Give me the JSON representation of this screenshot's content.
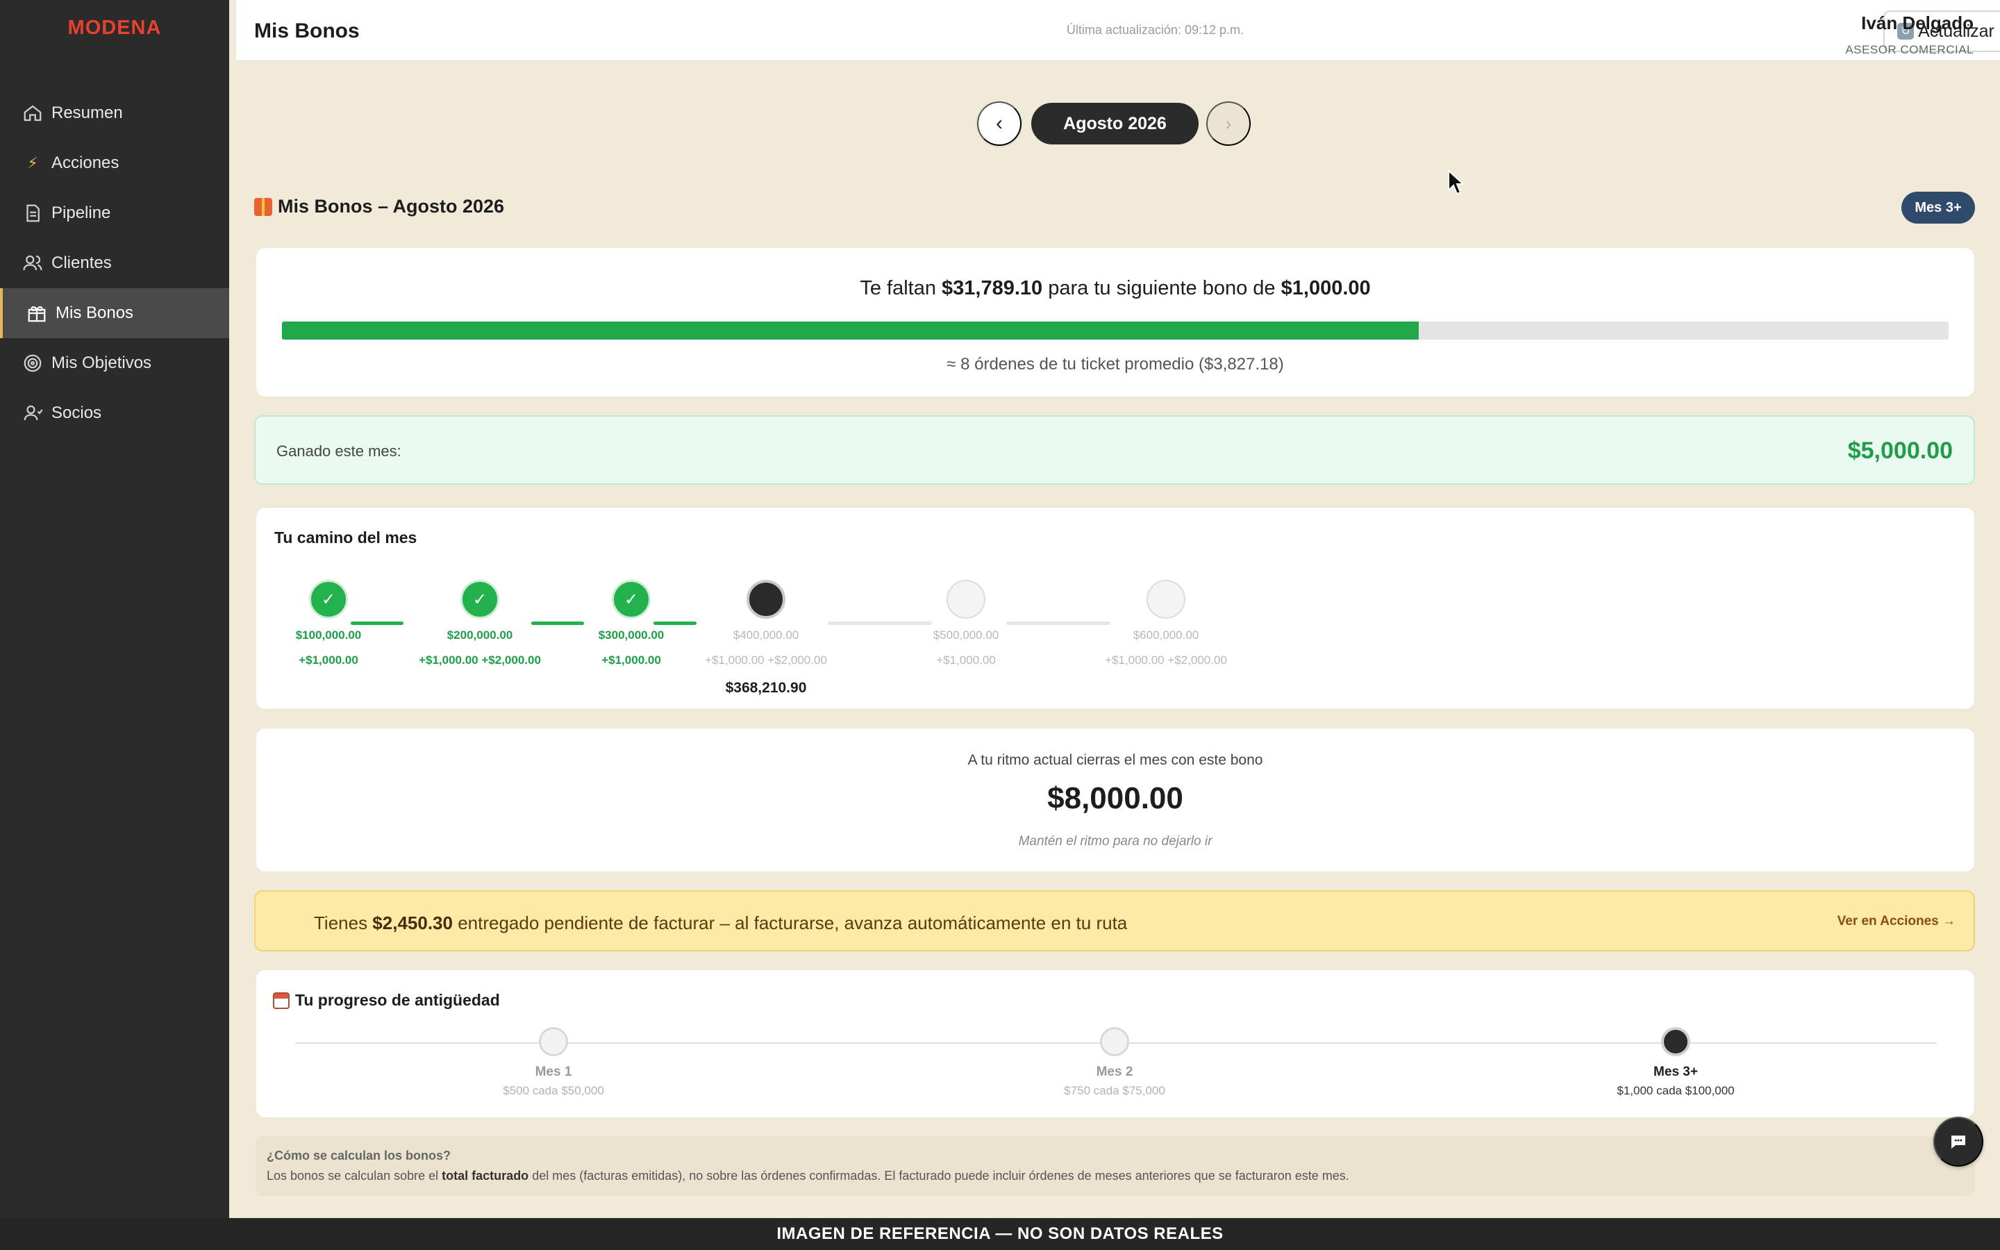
{
  "sidebar": {
    "brand": "MODENA",
    "items": [
      {
        "label": "Resumen",
        "icon": "home-icon"
      },
      {
        "label": "Acciones",
        "icon": "bolt-icon"
      },
      {
        "label": "Pipeline",
        "icon": "document-icon"
      },
      {
        "label": "Clientes",
        "icon": "users-icon"
      },
      {
        "label": "Mis Bonos",
        "icon": "gift-icon",
        "active": true
      },
      {
        "label": "Mis Objetivos",
        "icon": "target-icon"
      },
      {
        "label": "Socios",
        "icon": "user-icon"
      }
    ]
  },
  "header": {
    "title": "Mis Bonos",
    "updated": "Última actualización: 09:12 p.m.",
    "refresh_label": "Actualizar",
    "user_name": "Iván Delgado",
    "user_role": "ASESOR COMERCIAL"
  },
  "month_nav": {
    "prev": "‹",
    "current": "Agosto 2026",
    "next": "›"
  },
  "bonus_section": {
    "title": "Mis Bonos – Agosto 2026",
    "tier_badge": "Mes 3+"
  },
  "progress": {
    "text_before": "Te faltan ",
    "remaining": "$31,789.10",
    "text_middle": " para tu siguiente bono de ",
    "next_bonus": "$1,000.00",
    "fill_percent": 68.2,
    "orders_note": "≈ 8 órdenes de tu ticket promedio ($3,827.18)"
  },
  "earned": {
    "label": "Ganado este mes:",
    "value": "$5,000.00"
  },
  "path": {
    "title": "Tu camino del mes",
    "stages": [
      {
        "amount": "$100,000.00",
        "bonus": "+$1,000.00",
        "state": "done"
      },
      {
        "amount": "$200,000.00",
        "bonus": "+$1,000.00 +$2,000.00",
        "state": "done"
      },
      {
        "amount": "$300,000.00",
        "bonus": "+$1,000.00",
        "state": "done"
      },
      {
        "amount": "$400,000.00",
        "bonus": "+$1,000.00 +$2,000.00",
        "state": "current"
      },
      {
        "amount": "$500,000.00",
        "bonus": "+$1,000.00",
        "state": "pending"
      },
      {
        "amount": "$600,000.00",
        "bonus": "+$1,000.00 +$2,000.00",
        "state": "pending"
      }
    ],
    "current_value": "$368,210.90",
    "check": "✓"
  },
  "forecast": {
    "label": "A tu ritmo actual cierras el mes con este bono",
    "value": "$8,000.00",
    "note": "Mantén el ritmo para no dejarlo ir"
  },
  "pending": {
    "text_before": "Tienes ",
    "amount": "$2,450.30",
    "text_after": " entregado pendiente de facturar – al facturarse, avanza automáticamente en tu ruta",
    "link": "Ver en Acciones →"
  },
  "seniority": {
    "title": "Tu progreso de antigüedad",
    "steps": [
      {
        "name": "Mes 1",
        "rate": "$500 cada $50,000",
        "active": false
      },
      {
        "name": "Mes 2",
        "rate": "$750 cada $75,000",
        "active": false
      },
      {
        "name": "Mes 3+",
        "rate": "$1,000 cada $100,000",
        "active": true
      }
    ]
  },
  "info": {
    "question": "¿Cómo se calculan los bonos?",
    "answer_before": "Los bonos se calculan sobre el ",
    "answer_bold": "total facturado",
    "answer_after": " del mes (facturas emitidas), no sobre las órdenes confirmadas. El facturado puede incluir órdenes de meses anteriores que se facturaron este mes."
  },
  "footer": {
    "text": "IMAGEN DE REFERENCIA — NO SON DATOS REALES"
  },
  "colors": {
    "brand": "#e8412f",
    "accent_green": "#22a84a",
    "sidebar_bg": "#2b2b2b",
    "page_bg": "#f1ead8",
    "badge_blue": "#2f4a6a",
    "pending_bg": "#fdeaa6"
  }
}
